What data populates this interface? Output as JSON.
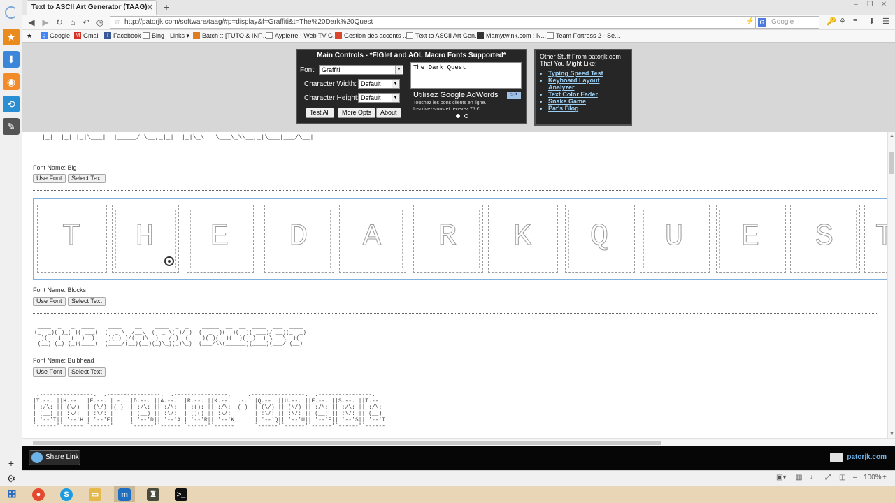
{
  "browser": {
    "tab_title": "Text to ASCII Art Generator (TAAG)",
    "url": "http://patorjk.com/software/taag/#p=display&f=Graffiti&t=The%20Dark%20Quest",
    "search_placeholder": "Google",
    "zoom": "100%"
  },
  "bookmarks": [
    {
      "label": "Google",
      "color": "#4285f4"
    },
    {
      "label": "Gmail",
      "color": "#d93025"
    },
    {
      "label": "Facebook",
      "color": "#3b5998"
    },
    {
      "label": "Bing",
      "color": "#888888"
    },
    {
      "label": "Links ▾",
      "color": "#f7f7f7"
    },
    {
      "label": "Batch :: [TUTO & INF...",
      "color": "#e07b1f"
    },
    {
      "label": "Aypierre - Web TV G...",
      "color": "#999999"
    },
    {
      "label": "Gestion des accents ...",
      "color": "#d9472b"
    },
    {
      "label": "Text to ASCII Art Gen...",
      "color": "#dddddd"
    },
    {
      "label": "Mamytwink.com : N...",
      "color": "#333333"
    },
    {
      "label": "Team Fortress 2 - Se...",
      "color": "#dddddd"
    }
  ],
  "main_controls": {
    "title": "Main Controls - *FIGlet and AOL Macro Fonts Supported*",
    "font_label": "Font:",
    "font_value": "Graffiti",
    "char_width_label": "Character Width:",
    "char_width_value": "Default",
    "char_height_label": "Character Height:",
    "char_height_value": "Default",
    "test_all": "Test All",
    "more_opts": "More Opts",
    "about": "About",
    "input_text": "The Dark Quest"
  },
  "ad": {
    "title": "Utilisez Google AdWords",
    "line1": "Touchez les bons clients en ligne.",
    "line2": "Inscrivez-vous et recevez 75 €"
  },
  "other_stuff": {
    "title": "Other Stuff From patorjk.com That You Might Like:",
    "links": [
      "Typing Speed Test",
      "Keyboard Layout Analyzer",
      "Text Color Fader",
      "Snake Game",
      "Pat's Blog"
    ]
  },
  "results": {
    "use_font": "Use Font",
    "select_text": "Select Text",
    "big_name": "Font Name: Big",
    "blocks_name": "Font Name: Blocks",
    "bulbhead_name": "Font Name: Bulbhead",
    "big_partial": "  |_|  |_| |_|\\___|  |_____/ \\__,_|_|  |_|\\_\\   \\___\\_\\\\__,_|\\___|___/\\__|",
    "blocks_letters": [
      "T",
      "H",
      "E",
      "D",
      "A",
      "R",
      "K",
      "Q",
      "U",
      "E",
      "S",
      "T"
    ],
    "bulbhead_art": " ____  _   _  ____    ____    __    ____  _  _    _____  __  __  ____  ___  ____\n(_  _)( )_( )( ___)  (  _ \\  /__\\  (  _ \\( )/ )  (  _  )(  )(  )( ___)/ __)(_  _)\n  )(   ) _ (  )__)    )(_) )/(__)\\  )   / )  (    )(_)(  )(__)(  )__) \\__ \\  )(\n (__) (_) (_)(____)  (____/(__)(__)(_)\\_)(_)\\_)  (___/\\\\(______)(____)(___/ (__)",
    "bubble_art": " .----------------.  .----------------.  .----------------.     .----------------.  .----------------.\n|T.--. ||H.--. ||E.--. |.-.  |D.--. ||A.--. ||R.--. ||K.--. |.-.  |Q.--. ||U.--. ||E.--. ||S.--. ||T.--. |\n| :/\\: || (\\/) || (\\/) |(_)  | :/\\: || :/\\: || :(): || :/\\: |(_)  | (\\/) || (\\/) || :/\\: || :/\\: || :/\\: |\n| (__) || :\\/: || :\\/: |     | (__) || :\\/: || ()() || :\\/: |     | :\\/: || :\\/: || (__) || :\\/: || (__) |\n| '--'T|| '--'H|| '--'E|     | '--'D|| '--'A|| '--'R|| '--'K|     | '--'Q|| '--'U|| '--'E|| '--'S|| '--'T|\n`------'`------'`------'     `------'`------'`------'`------'     `------'`------'`------'`------'`------'"
  },
  "share": {
    "label": "Share Link",
    "site": "patorjk.com"
  }
}
